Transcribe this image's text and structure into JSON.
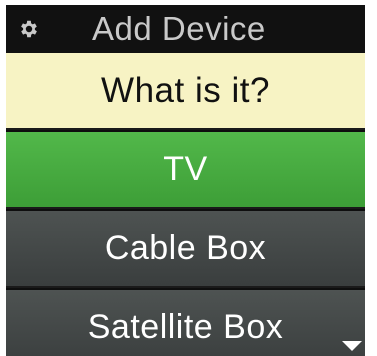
{
  "header": {
    "title": "Add Device",
    "icon": "gear-icon"
  },
  "prompt": {
    "text": "What is it?"
  },
  "options": [
    {
      "label": "TV",
      "selected": true
    },
    {
      "label": "Cable Box",
      "selected": false
    },
    {
      "label": "Satellite Box",
      "selected": false
    }
  ],
  "scroll": {
    "icon": "scroll-down-arrow-icon"
  },
  "colors": {
    "header_bg": "#111111",
    "header_text": "#c9c9c9",
    "prompt_bg": "#f7f3c4",
    "selected_bg": "#48ab40",
    "option_bg": "#444948"
  }
}
